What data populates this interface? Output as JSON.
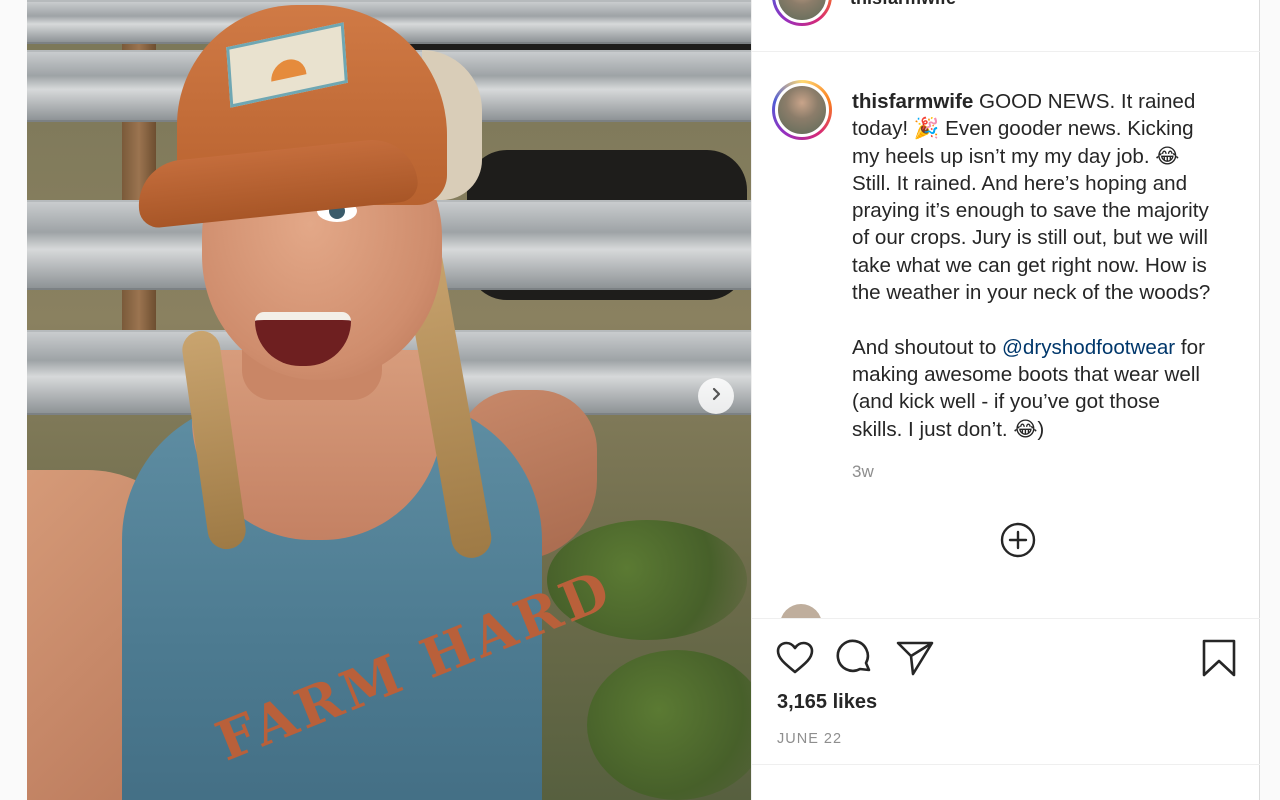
{
  "post": {
    "username": "thisfarmwife",
    "caption_lines": [
      "GOOD NEWS. It rained",
      "today! 🎉 Even gooder news. Kicking",
      "my heels up isn’t my my day job. 😂",
      "Still. It rained. And here’s hoping and",
      "praying it’s enough to save the majority",
      "of our crops. Jury is still out, but we will",
      "take what we can get right now. How is",
      "the weather in your neck of the woods?"
    ],
    "shoutout_prefix": "And shoutout to ",
    "mention": "@dryshodfootwear",
    "shoutout_rest_lines": [
      " for",
      "making awesome boots that wear well",
      "(and kick well - if you’ve got those",
      "skills. I just don’t. 😂)"
    ],
    "time_ago": "3w",
    "likes": "3,165 likes",
    "date": "JUNE 22"
  },
  "header": {
    "username": "thisfarmwife",
    "more": "···"
  },
  "photo": {
    "shirt_text": "FARM HARD"
  },
  "icons": {
    "next": "chevron-right-icon",
    "load_more": "plus-circle-icon",
    "like": "heart-icon",
    "comment": "comment-bubble-icon",
    "share": "paper-plane-icon",
    "save": "bookmark-icon"
  },
  "colors": {
    "mention": "#00376b",
    "muted": "#8e8e8e",
    "text": "#262626"
  }
}
